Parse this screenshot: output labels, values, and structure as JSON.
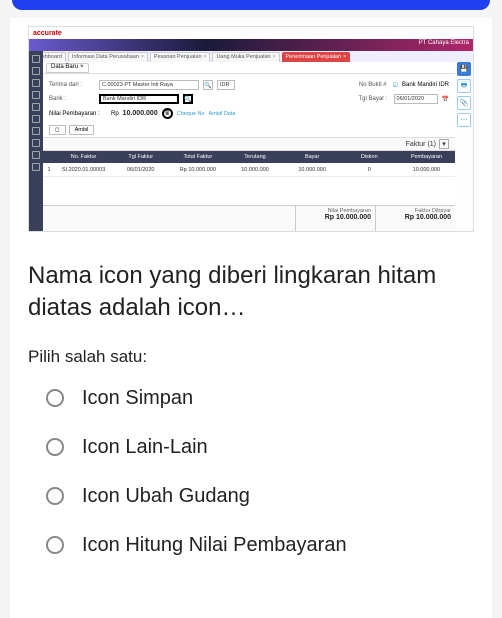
{
  "app": {
    "logo": "accurate",
    "company": "PT Cahaya Electra"
  },
  "tabs": [
    "Dashboard",
    "Informasi Data Perusahaan",
    "Pesanan Penjualan",
    "Uang Muka Penjualan",
    "Penerimaan Penjualan"
  ],
  "subtab": "Data Baru",
  "form": {
    "terima_label": "Terima dari :",
    "terima_value": "C.00023 PT Master Inti Raya",
    "cur": "IDR",
    "nobukti_label": "No Bukti #",
    "nobukti_chk": "Bank Mandiri IDR",
    "bank_label": "Bank :",
    "bank_value": "Bank Mandiri IDR",
    "tgl_label": "Tgl Bayar :",
    "tgl_value": "06/01/2020",
    "nilai_label": "Nilai Pembayaran :",
    "nilai_cur": "Rp",
    "nilai_amt": "10.000.000",
    "cheque": "Cheque No",
    "ambil": "Ambil Data"
  },
  "btns": {
    "b1": "",
    "b2": "Ambil"
  },
  "faktur": "Faktur (1)",
  "thead": [
    "",
    "No. Faktur",
    "Tgl Faktur",
    "Total Faktur",
    "Terutang",
    "Bayar",
    "Diskon",
    "Pembayaran"
  ],
  "trow": [
    "1",
    "SI.2020.01.00003",
    "06/01/2020",
    "Rp 10.000.000",
    "10.000.000",
    "10.000.000",
    "0",
    "10.000.000"
  ],
  "footer": {
    "l1": "Nilai Pembayaran",
    "v1": "Rp 10.000.000",
    "l2": "Faktur Dibayar",
    "v2": "Rp 10.000.000"
  },
  "question": "Nama icon yang diberi lingkaran hitam diatas adalah icon…",
  "instr": "Pilih salah satu:",
  "options": [
    "Icon Simpan",
    "Icon Lain-Lain",
    "Icon Ubah Gudang",
    "Icon Hitung Nilai Pembayaran"
  ]
}
